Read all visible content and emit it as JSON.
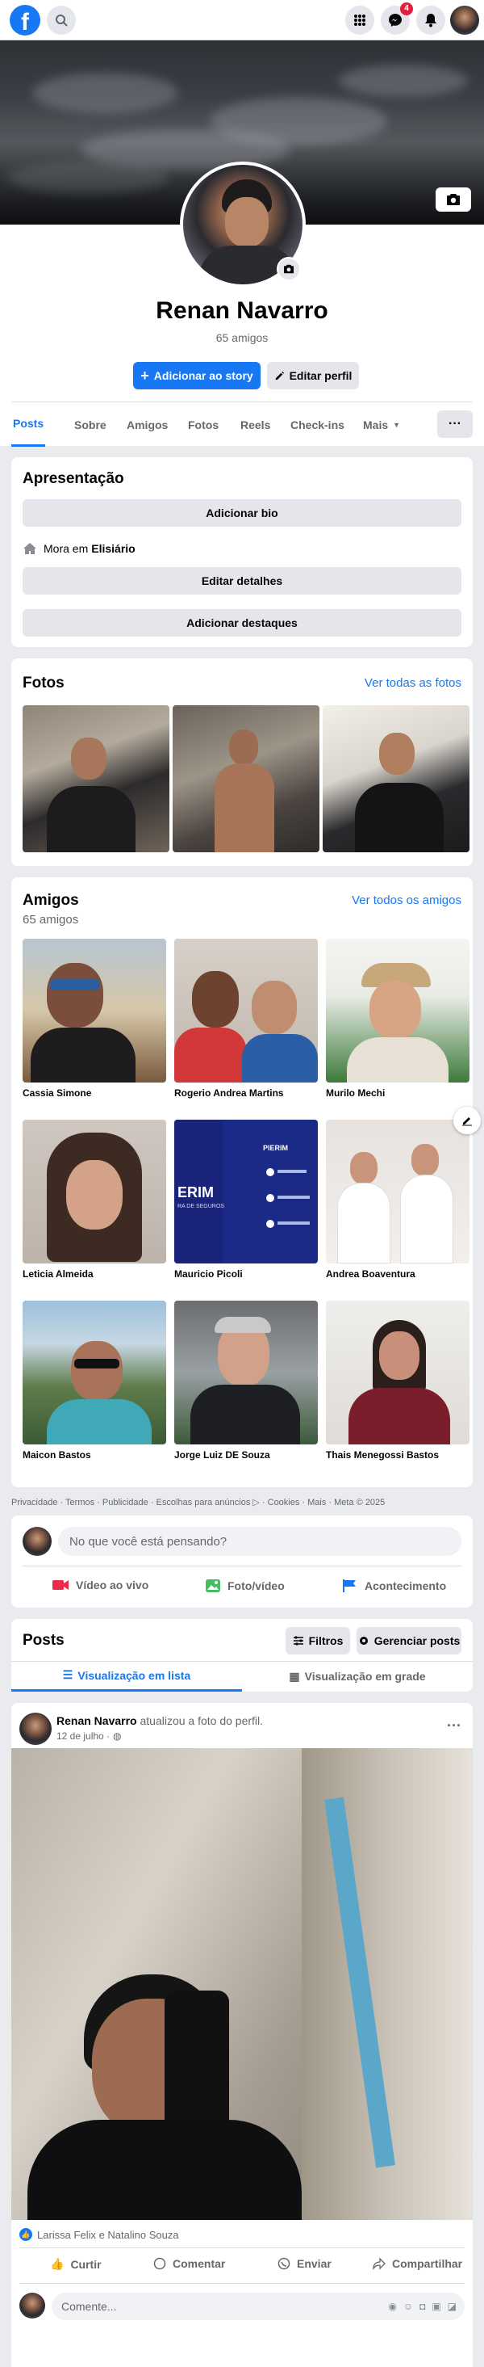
{
  "topbar": {
    "logo": "f",
    "messenger_badge": "4"
  },
  "profile": {
    "name": "Renan Navarro",
    "friends_count": "65 amigos",
    "add_story_label": "Adicionar ao story",
    "edit_profile_label": "Editar perfil"
  },
  "tabs": [
    "Posts",
    "Sobre",
    "Amigos",
    "Fotos",
    "Reels",
    "Check-ins",
    "Mais"
  ],
  "tabs_more_button": "···",
  "intro": {
    "title": "Apresentação",
    "add_bio": "Adicionar bio",
    "lives_prefix": "Mora em",
    "lives_city": "Elisiário",
    "edit_details": "Editar detalhes",
    "add_featured": "Adicionar destaques"
  },
  "photos": {
    "title": "Fotos",
    "see_all": "Ver todas as fotos"
  },
  "friends": {
    "title": "Amigos",
    "count": "65 amigos",
    "see_all": "Ver todos os amigos",
    "items": [
      {
        "name": "Cassia Simone"
      },
      {
        "name": "Rogerio Andrea Martins"
      },
      {
        "name": "Murilo Mechi"
      },
      {
        "name": "Leticia Almeida"
      },
      {
        "name": "Mauricio Picoli"
      },
      {
        "name": "Andrea Boaventura"
      },
      {
        "name": "Maicon Bastos"
      },
      {
        "name": "Jorge Luiz DE Souza"
      },
      {
        "name": "Thais Menegossi Bastos"
      }
    ],
    "card_brand": "PIERIM",
    "card_brand_partial": "ERIM",
    "card_sub": "RA DE SEGUROS"
  },
  "footer": "Privacidade · Termos · Publicidade · Escolhas para anúncios ▷ · Cookies · Mais · Meta © 2025",
  "composer": {
    "placeholder": "No que você está pensando?",
    "live": "Vídeo ao vivo",
    "photo": "Foto/vídeo",
    "event": "Acontecimento"
  },
  "posts_header": {
    "title": "Posts",
    "filters": "Filtros",
    "manage": "Gerenciar posts",
    "list_view": "Visualização em lista",
    "grid_view": "Visualização em grade"
  },
  "post": {
    "author": "Renan Navarro",
    "action": "atualizou a foto do perfil.",
    "date": "12 de julho ·",
    "reactions": "Larissa Felix e Natalino Souza",
    "like": "Curtir",
    "comment": "Comentar",
    "send": "Enviar",
    "share": "Compartilhar",
    "comment_placeholder": "Comente..."
  },
  "colors": {
    "accent": "#1877f2",
    "background": "#e9ebee",
    "badge": "#e41e3f"
  }
}
